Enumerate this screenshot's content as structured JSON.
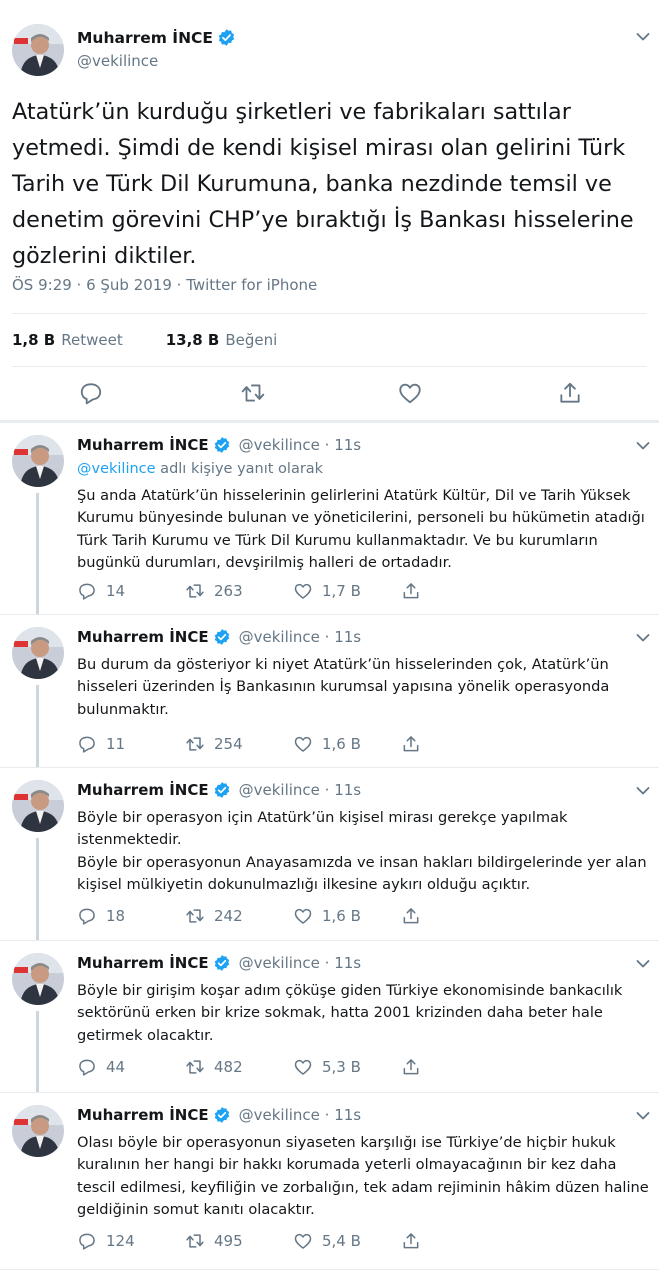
{
  "main_tweet": {
    "author_name": "Muharrem İNCE",
    "handle": "@vekilince",
    "text": "Atatürk’ün kurduğu şirketleri ve fabrikaları sattılar yetmedi. Şimdi de kendi kişisel mirası olan gelirini Türk Tarih ve Türk Dil Kurumuna, banka nezdinde temsil ve denetim görevini CHP’ye bıraktığı İş Bankası hisselerine gözlerini diktiler.",
    "timestamp": "ÖS 9:29 · 6 Şub 2019 · Twitter for iPhone",
    "retweets_count": "1,8 B",
    "retweets_label": "Retweet",
    "likes_count": "13,8 B",
    "likes_label": "Beğeni"
  },
  "replies": [
    {
      "author_name": "Muharrem İNCE",
      "handle": "@vekilince · 11s",
      "reply_to_handle": "@vekilince",
      "reply_to_suffix": " adlı kişiye yanıt olarak",
      "text": "Şu anda Atatürk’ün hisselerinin gelirlerini Atatürk Kültür, Dil ve Tarih Yüksek Kurumu bünyesinde bulunan ve yöneticilerini, personeli bu hükümetin atadığı Türk Tarih Kurumu ve Türk Dil Kurumu kullanmaktadır. Ve bu kurumların bugünkü durumları, devşirilmiş halleri de ortadadır.",
      "replies": "14",
      "retweets": "263",
      "likes": "1,7 B"
    },
    {
      "author_name": "Muharrem İNCE",
      "handle": "@vekilince · 11s",
      "text": "Bu durum da gösteriyor ki niyet Atatürk’ün hisselerinden çok, Atatürk’ün hisseleri üzerinden İş Bankasının kurumsal yapısına yönelik operasyonda bulunmaktır.",
      "replies": "11",
      "retweets": "254",
      "likes": "1,6 B"
    },
    {
      "author_name": "Muharrem İNCE",
      "handle": "@vekilince · 11s",
      "text": "Böyle bir operasyon için Atatürk’ün kişisel mirası gerekçe yapılmak istenmektedir.\nBöyle bir operasyonun Anayasamızda ve insan hakları bildirgelerinde yer alan kişisel mülkiyetin dokunulmazlığı ilkesine aykırı olduğu açıktır.",
      "replies": "18",
      "retweets": "242",
      "likes": "1,6 B"
    },
    {
      "author_name": "Muharrem İNCE",
      "handle": "@vekilince · 11s",
      "text": "Böyle bir girişim koşar adım çöküşe giden Türkiye ekonomisinde bankacılık sektörünü erken bir krize sokmak, hatta 2001 krizinden daha beter hale getirmek olacaktır.",
      "replies": "44",
      "retweets": "482",
      "likes": "5,3 B"
    },
    {
      "author_name": "Muharrem İNCE",
      "handle": "@vekilince · 11s",
      "text": "Olası böyle bir operasyonun siyaseten karşılığı ise Türkiye’de hiçbir hukuk kuralının her hangi bir hakkı korumada yeterli olmayacağının bir kez daha tescil edilmesi, keyfiliğin ve zorbalığın, tek adam rejiminin hâkim düzen haline geldiğinin somut kanıtı olacaktır.",
      "replies": "124",
      "retweets": "495",
      "likes": "5,4 B"
    }
  ],
  "icons": {
    "reply": "reply-icon",
    "retweet": "retweet-icon",
    "like": "heart-icon",
    "share": "share-icon",
    "verified": "verified-badge-icon",
    "more": "chevron-down-icon"
  },
  "colors": {
    "link": "#1da1f2",
    "secondary_text": "#657786",
    "divider": "#e6ecf0",
    "thread_line": "#ccd6dd"
  }
}
